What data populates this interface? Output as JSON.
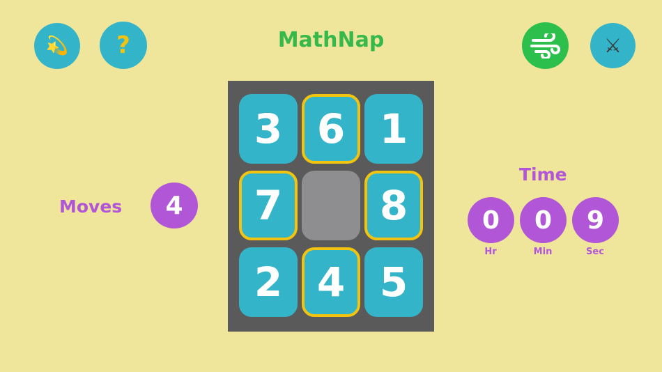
{
  "header": {
    "title": "MathNap",
    "left_buttons": [
      {
        "icon": "dizzy-star-icon",
        "glyph": "💫"
      },
      {
        "icon": "question-icon",
        "glyph": "?"
      }
    ],
    "right_buttons": [
      {
        "icon": "wind-icon"
      },
      {
        "icon": "crossed-swords-icon",
        "glyph": "⚔"
      }
    ]
  },
  "board": {
    "tiles": [
      "3",
      "6",
      "1",
      "7",
      "",
      "8",
      "2",
      "4",
      "5"
    ]
  },
  "moves": {
    "label": "Moves",
    "value": "4"
  },
  "timer": {
    "label": "Time",
    "hours": "0",
    "minutes": "0",
    "seconds": "9",
    "hours_label": "Hr",
    "minutes_label": "Min",
    "seconds_label": "Sec"
  },
  "colors": {
    "background": "#efe69c",
    "accent_blue": "#34b4c9",
    "accent_green": "#2dbf4b",
    "accent_purple": "#b056d6",
    "highlight": "#f2c410"
  }
}
